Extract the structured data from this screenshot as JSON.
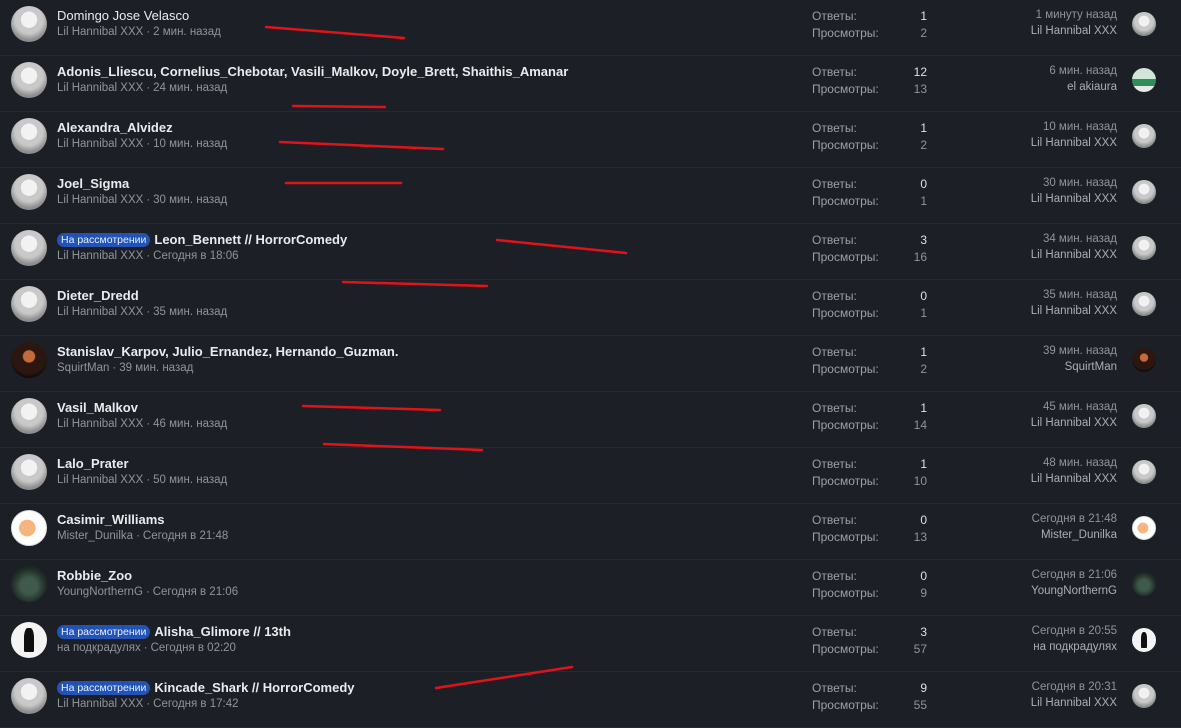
{
  "labels": {
    "replies": "Ответы:",
    "views": "Просмотры:"
  },
  "threads": [
    {
      "badge": "",
      "title": "Domingo Jose Velasco",
      "bold": false,
      "author": "Lil Hannibal XXX",
      "time": "2 мин. назад",
      "replies": "1",
      "views": "2",
      "last_time": "1 минуту назад",
      "last_user": "Lil Hannibal XXX",
      "avatar": "chef",
      "last_avatar": "chef"
    },
    {
      "badge": "",
      "title": "Adonis_Lliescu, Cornelius_Chebotar, Vasili_Malkov, Doyle_Brett, Shaithis_Amanar",
      "bold": true,
      "author": "Lil Hannibal XXX",
      "time": "24 мин. назад",
      "replies": "12",
      "views": "13",
      "last_time": "6 мин. назад",
      "last_user": "el akiaura",
      "avatar": "chef",
      "last_avatar": "land"
    },
    {
      "badge": "",
      "title": "Alexandra_Alvidez",
      "bold": true,
      "author": "Lil Hannibal XXX",
      "time": "10 мин. назад",
      "replies": "1",
      "views": "2",
      "last_time": "10 мин. назад",
      "last_user": "Lil Hannibal XXX",
      "avatar": "chef",
      "last_avatar": "chef"
    },
    {
      "badge": "",
      "title": "Joel_Sigma",
      "bold": true,
      "author": "Lil Hannibal XXX",
      "time": "30 мин. назад",
      "replies": "0",
      "views": "1",
      "last_time": "30 мин. назад",
      "last_user": "Lil Hannibal XXX",
      "avatar": "chef",
      "last_avatar": "chef"
    },
    {
      "badge": "На рассмотрении",
      "title": "Leon_Bennett // HorrorComedy",
      "bold": true,
      "author": "Lil Hannibal XXX",
      "time": "Сегодня в 18:06",
      "replies": "3",
      "views": "16",
      "last_time": "34 мин. назад",
      "last_user": "Lil Hannibal XXX",
      "avatar": "chef",
      "last_avatar": "chef"
    },
    {
      "badge": "",
      "title": "Dieter_Dredd",
      "bold": true,
      "author": "Lil Hannibal XXX",
      "time": "35 мин. назад",
      "replies": "0",
      "views": "1",
      "last_time": "35 мин. назад",
      "last_user": "Lil Hannibal XXX",
      "avatar": "chef",
      "last_avatar": "chef"
    },
    {
      "badge": "",
      "title": "Stanislav_Karpov, Julio_Ernandez, Hernando_Guzman.",
      "bold": true,
      "author": "SquirtMan",
      "time": "39 мин. назад",
      "replies": "1",
      "views": "2",
      "last_time": "39 мин. назад",
      "last_user": "SquirtMan",
      "avatar": "dark",
      "last_avatar": "dark"
    },
    {
      "badge": "",
      "title": "Vasil_Malkov",
      "bold": true,
      "author": "Lil Hannibal XXX",
      "time": "46 мин. назад",
      "replies": "1",
      "views": "14",
      "last_time": "45 мин. назад",
      "last_user": "Lil Hannibal XXX",
      "avatar": "chef",
      "last_avatar": "chef"
    },
    {
      "badge": "",
      "title": "Lalo_Prater",
      "bold": true,
      "author": "Lil Hannibal XXX",
      "time": "50 мин. назад",
      "replies": "1",
      "views": "10",
      "last_time": "48 мин. назад",
      "last_user": "Lil Hannibal XXX",
      "avatar": "chef",
      "last_avatar": "chef"
    },
    {
      "badge": "",
      "title": "Casimir_Williams",
      "bold": true,
      "author": "Mister_Dunilka",
      "time": "Сегодня в 21:48",
      "replies": "0",
      "views": "13",
      "last_time": "Сегодня в 21:48",
      "last_user": "Mister_Dunilka",
      "avatar": "pig",
      "last_avatar": "pig"
    },
    {
      "badge": "",
      "title": "Robbie_Zoo",
      "bold": true,
      "author": "YoungNorthernG",
      "time": "Сегодня в 21:06",
      "replies": "0",
      "views": "9",
      "last_time": "Сегодня в 21:06",
      "last_user": "YoungNorthernG",
      "avatar": "green",
      "last_avatar": "green"
    },
    {
      "badge": "На рассмотрении",
      "title": "Alisha_Glimore // 13th",
      "bold": true,
      "author": "на подкрадулях",
      "time": "Сегодня в 02:20",
      "replies": "3",
      "views": "57",
      "last_time": "Сегодня в 20:55",
      "last_user": "на подкрадулях",
      "avatar": "sil",
      "last_avatar": "sil"
    },
    {
      "badge": "На рассмотрении",
      "title": "Kincade_Shark // HorrorComedy",
      "bold": true,
      "author": "Lil Hannibal XXX",
      "time": "Сегодня в 17:42",
      "replies": "9",
      "views": "55",
      "last_time": "Сегодня в 20:31",
      "last_user": "Lil Hannibal XXX",
      "avatar": "chef",
      "last_avatar": "chef"
    }
  ],
  "annotation_color": "#e0131a"
}
